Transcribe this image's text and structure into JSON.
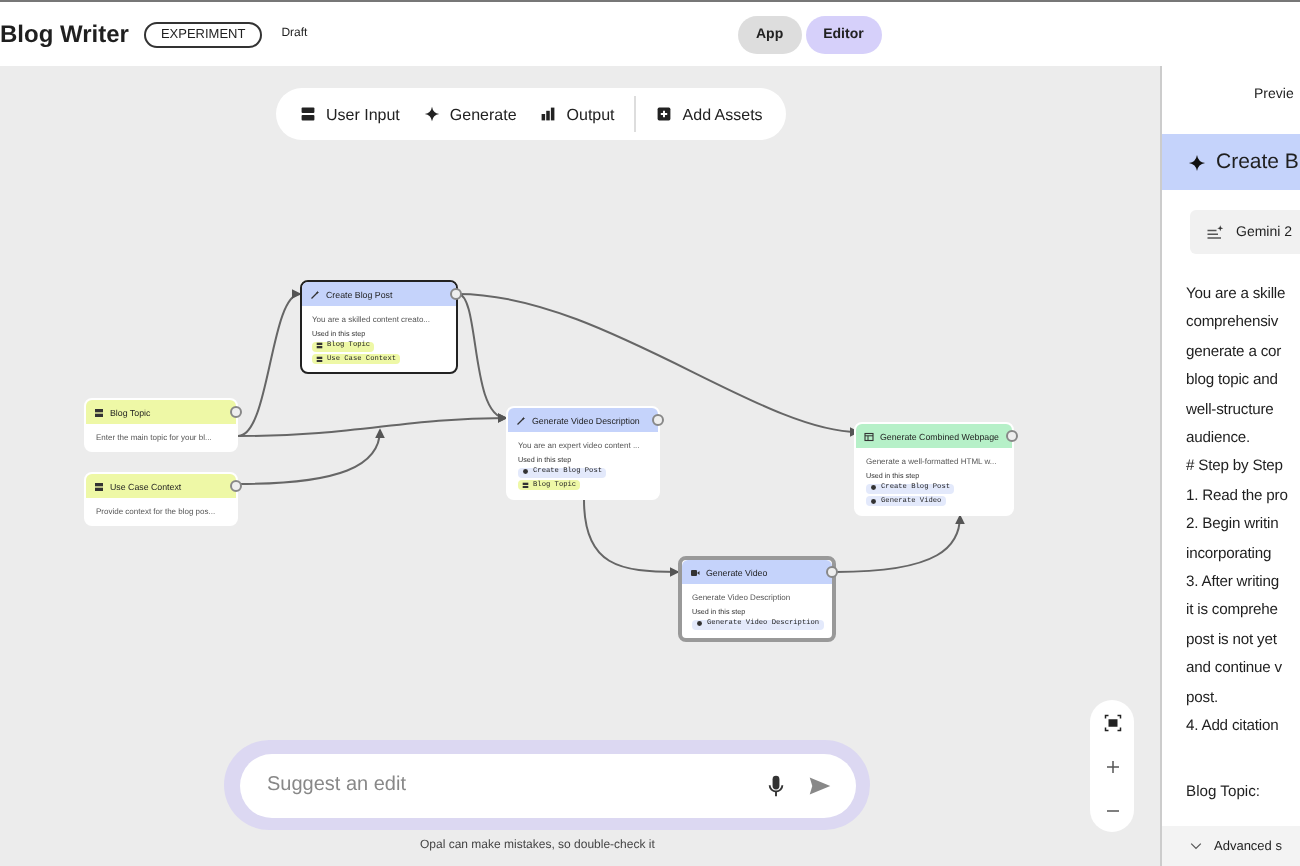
{
  "header": {
    "title": "Blog Writer",
    "badge": "EXPERIMENT",
    "status": "Draft",
    "modes": [
      {
        "label": "App",
        "selected": false
      },
      {
        "label": "Editor",
        "selected": true
      }
    ]
  },
  "toolbar": [
    {
      "kind": "input",
      "label": "User Input"
    },
    {
      "kind": "generate",
      "label": "Generate"
    },
    {
      "kind": "output",
      "label": "Output"
    },
    {
      "kind": "assets",
      "label": "Add Assets"
    }
  ],
  "nodes": [
    {
      "kind": "generate",
      "title": "Create Blog Post",
      "selected": true,
      "description": "You are a skilled content creato...",
      "used_label": "Used in this step",
      "used": [
        {
          "kind": "input",
          "label": "Blog Topic"
        },
        {
          "kind": "input",
          "label": "Use Case Context"
        }
      ]
    },
    {
      "kind": "input",
      "title": "Blog Topic",
      "selected": false,
      "description": "Enter the main topic for your bl..."
    },
    {
      "kind": "input",
      "title": "Use Case Context",
      "selected": false,
      "description": "Provide context for the blog pos..."
    },
    {
      "kind": "generate",
      "title": "Generate Video Description",
      "selected": false,
      "description": "You are an expert video content ...",
      "used_label": "Used in this step",
      "used": [
        {
          "kind": "generate",
          "label": "Create Blog Post"
        },
        {
          "kind": "input",
          "label": "Blog Topic"
        }
      ]
    },
    {
      "kind": "output",
      "title": "Generate Combined Webpage",
      "selected": false,
      "description": "Generate a well-formatted HTML w...",
      "used_label": "Used in this step",
      "used": [
        {
          "kind": "generate",
          "label": "Create Blog Post"
        },
        {
          "kind": "generate",
          "label": "Generate Video"
        }
      ]
    },
    {
      "kind": "video",
      "title": "Generate Video",
      "selected": false,
      "description": "Generate Video Description",
      "used_label": "Used in this step",
      "used": [
        {
          "kind": "generate",
          "label": "Generate Video Description"
        }
      ]
    }
  ],
  "chat": {
    "placeholder": "Suggest an edit",
    "disclaimer": "Opal can make mistakes, so double-check it"
  },
  "panel": {
    "tab": "Previe",
    "step_title": "Create B",
    "model": "Gemini 2",
    "prompt_lines": [
      "You are a skille",
      "comprehensiv",
      "generate a cor",
      "blog topic and",
      "well-structure",
      "audience.",
      "# Step by Step",
      "1. Read the pro",
      "2. Begin writin",
      "incorporating",
      "3. After writing",
      "it is comprehe",
      "post is not yet",
      "and continue v",
      "post.",
      "4. Add citation"
    ],
    "section_label": "Blog Topic:",
    "advanced": "Advanced s"
  }
}
